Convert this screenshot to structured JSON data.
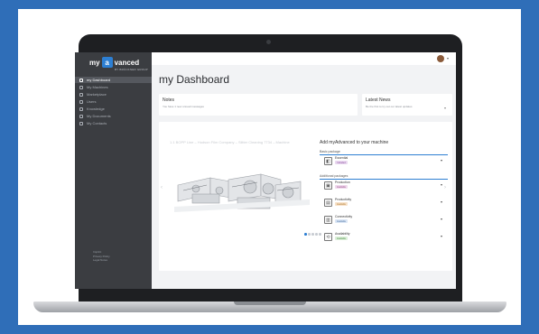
{
  "sidebar": {
    "logo": {
      "my": "my",
      "a": "a",
      "vanced": "vanced",
      "tagline": "BY BRÜCKNER GROUP"
    },
    "items": [
      {
        "label": "my Dashboard",
        "active": true,
        "icon": "dashboard-icon"
      },
      {
        "label": "My Machines",
        "active": false,
        "icon": "machine-icon"
      },
      {
        "label": "Marketplace",
        "active": false,
        "icon": "marketplace-icon"
      },
      {
        "label": "Users",
        "active": false,
        "icon": "users-icon"
      },
      {
        "label": "Knowledge",
        "active": false,
        "icon": "knowledge-icon"
      },
      {
        "label": "My Documents",
        "active": false,
        "icon": "documents-icon"
      },
      {
        "label": "My Contacts",
        "active": false,
        "icon": "contacts-icon"
      }
    ],
    "footer": [
      "Imprint",
      "Privacy Policy",
      "Legal Notes"
    ]
  },
  "header": {
    "title": "my Dashboard",
    "avatar_caret": "▾"
  },
  "notes": {
    "title": "Notes",
    "text": "You have 1 new unread messages"
  },
  "news": {
    "title": "Latest News",
    "text": "Be the first to try out our latest updates",
    "caret": "▾"
  },
  "machine": {
    "title": "1.1 BOPP Line – Hudson Film Company – Slitter Cleaning 7734 – Machine",
    "prev": "‹",
    "next": "›"
  },
  "packages": {
    "title": "Add myAdvanced to your machine",
    "basic_label": "Basic package",
    "additional_label": "Additional packages",
    "basic": {
      "name": "Essential",
      "badge": "Included",
      "badge_color": "#e9d8ef",
      "badge_text_color": "#8a4fa0",
      "icon": "essential-icon",
      "glyph": "◧"
    },
    "additional": [
      {
        "name": "Production",
        "badge": "Available",
        "badge_color": "#efd9ec",
        "badge_text_color": "#9a4c8a",
        "icon": "production-icon",
        "glyph": "▣"
      },
      {
        "name": "Productivity",
        "badge": "Available",
        "badge_color": "#f7e1c8",
        "badge_text_color": "#b07a2e",
        "icon": "productivity-icon",
        "glyph": "▤"
      },
      {
        "name": "Connectivity",
        "badge": "Available",
        "badge_color": "#dbe6f5",
        "badge_text_color": "#4f76a6",
        "icon": "connectivity-icon",
        "glyph": "▥"
      },
      {
        "name": "Availability",
        "badge": "Available",
        "badge_color": "#dcefd9",
        "badge_text_color": "#4e8f46",
        "icon": "availability-icon",
        "glyph": "⟲"
      }
    ],
    "caret": "▾"
  },
  "carousel": {
    "count": 5,
    "active": 0
  },
  "colors": {
    "background": "#2f6eb8",
    "accent": "#2d7fd3",
    "sidebar": "#3b3d41"
  }
}
